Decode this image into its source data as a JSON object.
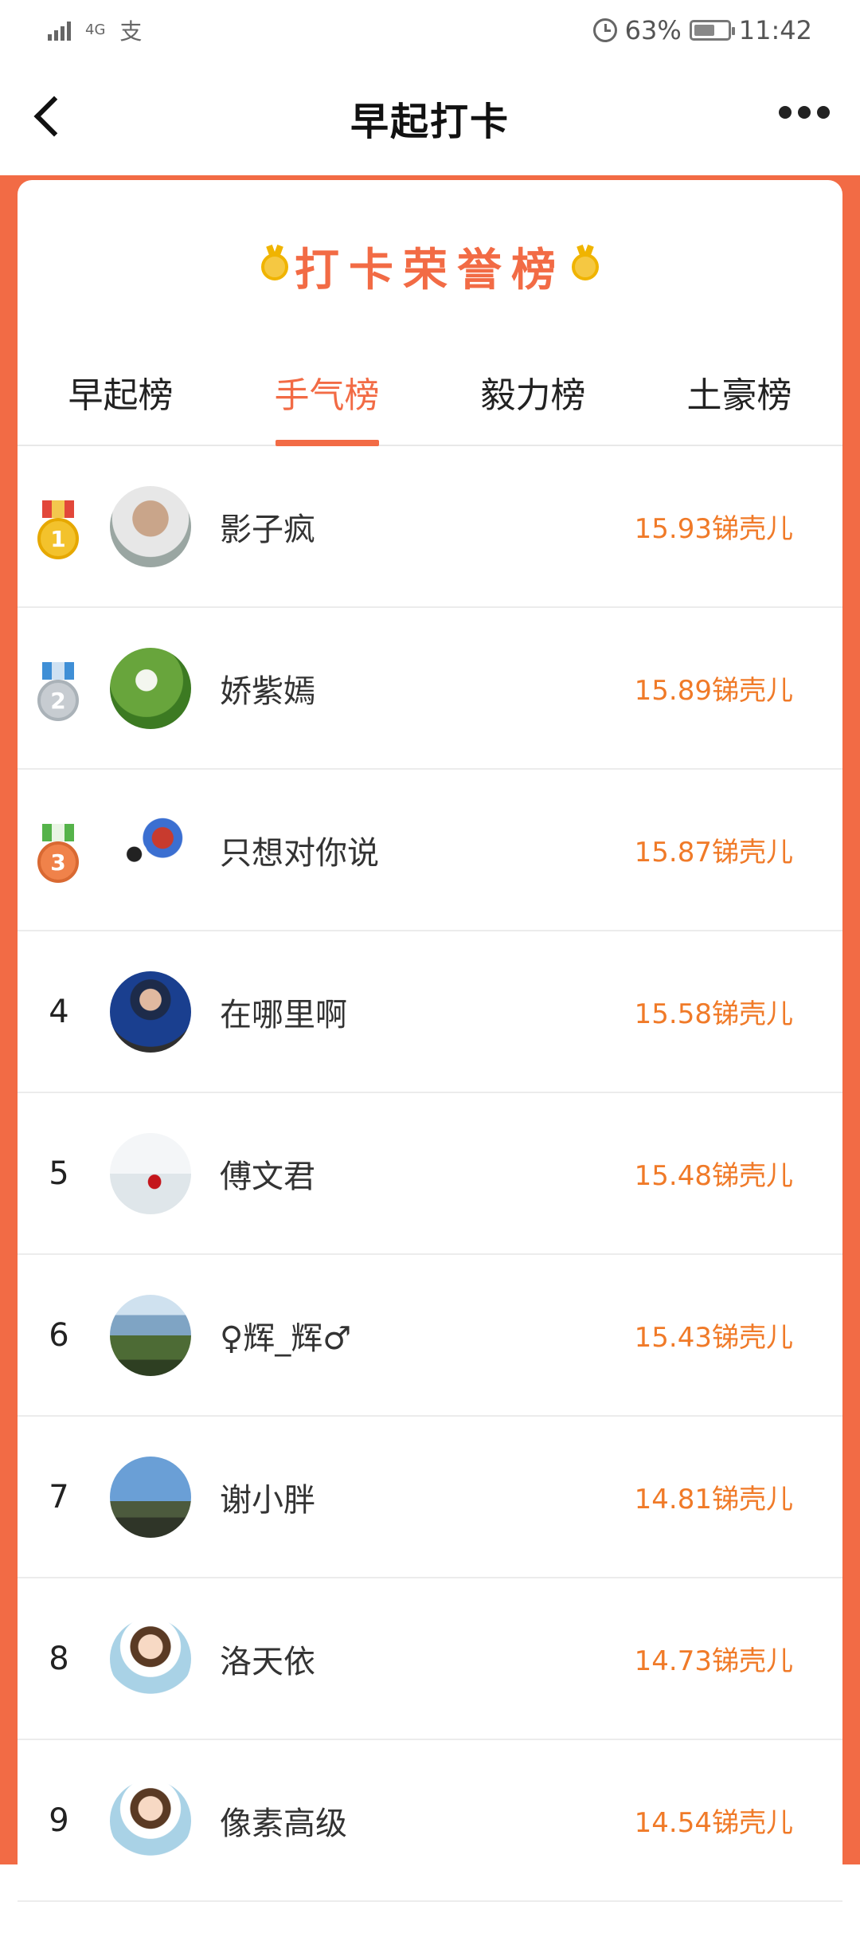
{
  "status_bar": {
    "network": "4G",
    "carrier_icon_text": "支",
    "battery": "63%",
    "time": "11:42"
  },
  "nav": {
    "title": "早起打卡"
  },
  "honor_title": "打卡荣誉榜",
  "tabs": [
    {
      "label": "早起榜",
      "active": false
    },
    {
      "label": "手气榜",
      "active": true
    },
    {
      "label": "毅力榜",
      "active": false
    },
    {
      "label": "土豪榜",
      "active": false
    }
  ],
  "rows": [
    {
      "rank": "1",
      "name": "影子疯",
      "value": "15.93锑壳儿"
    },
    {
      "rank": "2",
      "name": "娇紫嫣",
      "value": "15.89锑壳儿"
    },
    {
      "rank": "3",
      "name": "只想对你说",
      "value": "15.87锑壳儿"
    },
    {
      "rank": "4",
      "name": "在哪里啊",
      "value": "15.58锑壳儿"
    },
    {
      "rank": "5",
      "name": "傅文君",
      "value": "15.48锑壳儿"
    },
    {
      "rank": "6",
      "name": "♀辉_辉♂",
      "value": "15.43锑壳儿"
    },
    {
      "rank": "7",
      "name": "谢小胖",
      "value": "14.81锑壳儿"
    },
    {
      "rank": "8",
      "name": "洛天依",
      "value": "14.73锑壳儿"
    },
    {
      "rank": "9",
      "name": "像素高级",
      "value": "14.54锑壳儿"
    }
  ],
  "colors": {
    "accent": "#f26b45",
    "value": "#f07a28"
  }
}
